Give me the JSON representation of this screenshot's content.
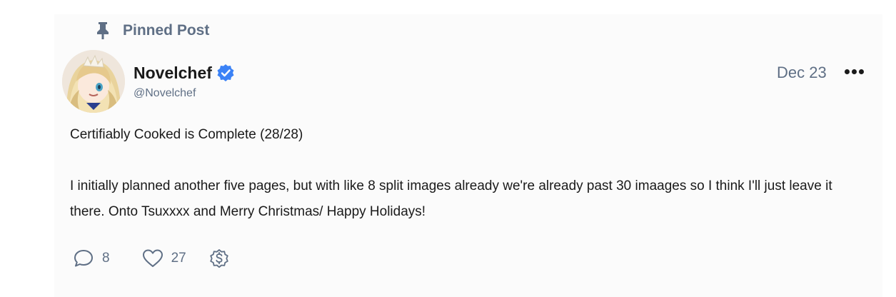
{
  "pinned": {
    "label": "Pinned Post",
    "icon": "pin-icon"
  },
  "post": {
    "author": {
      "name": "Novelchef",
      "handle": "@Novelchef",
      "verified": true,
      "verified_color": "#3b82f6"
    },
    "date": "Dec 23",
    "body": {
      "line1": "Certifiably Cooked is Complete (28/28)",
      "paragraph2": "I initially planned another five pages, but with like 8 split images already we're already past 30 imaages so I think I'll just leave it there. Onto Tsuxxxx and Merry Christmas/ Happy Holidays!"
    },
    "actions": {
      "comments": "8",
      "likes": "27",
      "tip_icon": "dollar-badge-icon"
    }
  },
  "colors": {
    "muted": "#5f6f85",
    "text": "#1a1a1a",
    "card_bg": "#fbfbfb"
  }
}
